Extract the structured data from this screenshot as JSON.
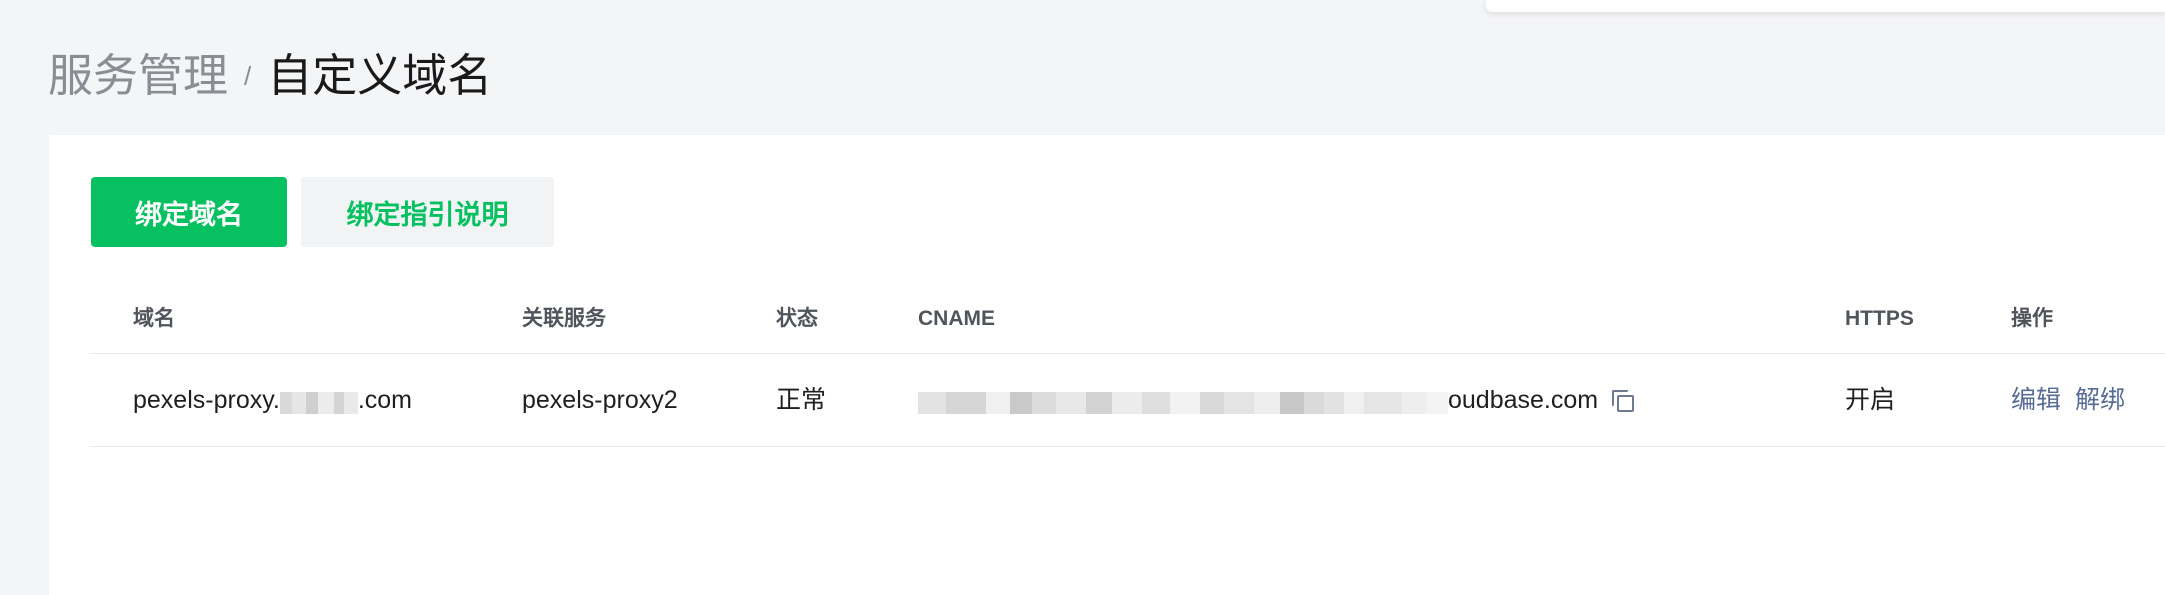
{
  "breadcrumb": {
    "parent": "服务管理",
    "separator": "/",
    "current": "自定义域名"
  },
  "toolbar": {
    "bind_domain_label": "绑定域名",
    "guide_label": "绑定指引说明"
  },
  "table": {
    "headers": {
      "domain": "域名",
      "service": "关联服务",
      "status": "状态",
      "cname": "CNAME",
      "https": "HTTPS",
      "actions": "操作"
    },
    "rows": [
      {
        "domain_prefix": "pexels-proxy.",
        "domain_suffix": ".com",
        "service": "pexels-proxy2",
        "status": "正常",
        "cname_suffix": "oudbase.com",
        "https": "开启",
        "edit_label": "编辑",
        "unbind_label": "解绑"
      }
    ]
  },
  "colors": {
    "primary": "#07c160",
    "link": "#576b95",
    "page_bg": "#f4f5f7"
  }
}
